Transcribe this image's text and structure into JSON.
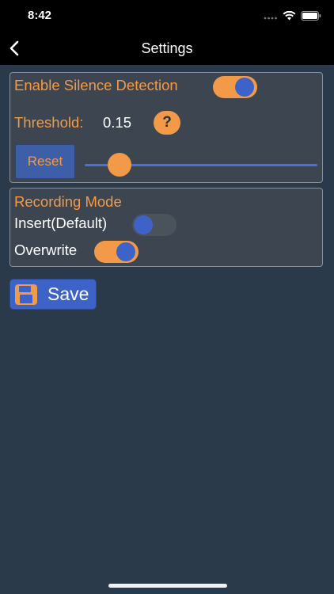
{
  "status_bar": {
    "time": "8:42"
  },
  "nav": {
    "title": "Settings",
    "back_icon": "chevron-left-icon"
  },
  "silence_panel": {
    "enable_label": "Enable Silence Detection",
    "enable_on": true,
    "threshold_label": "Threshold:",
    "threshold_value": "0.15",
    "help_icon_text": "?",
    "reset_label": "Reset",
    "slider_value": 0.15
  },
  "recording_panel": {
    "title": "Recording Mode",
    "insert_label": "Insert(Default)",
    "insert_on": false,
    "overwrite_label": "Overwrite",
    "overwrite_on": true
  },
  "save": {
    "label": "Save",
    "icon": "floppy-disk-icon"
  },
  "colors": {
    "background": "#2a3a4a",
    "accent_orange": "#f29a48",
    "accent_blue": "#3d63c8",
    "panel": "#3d4650"
  }
}
